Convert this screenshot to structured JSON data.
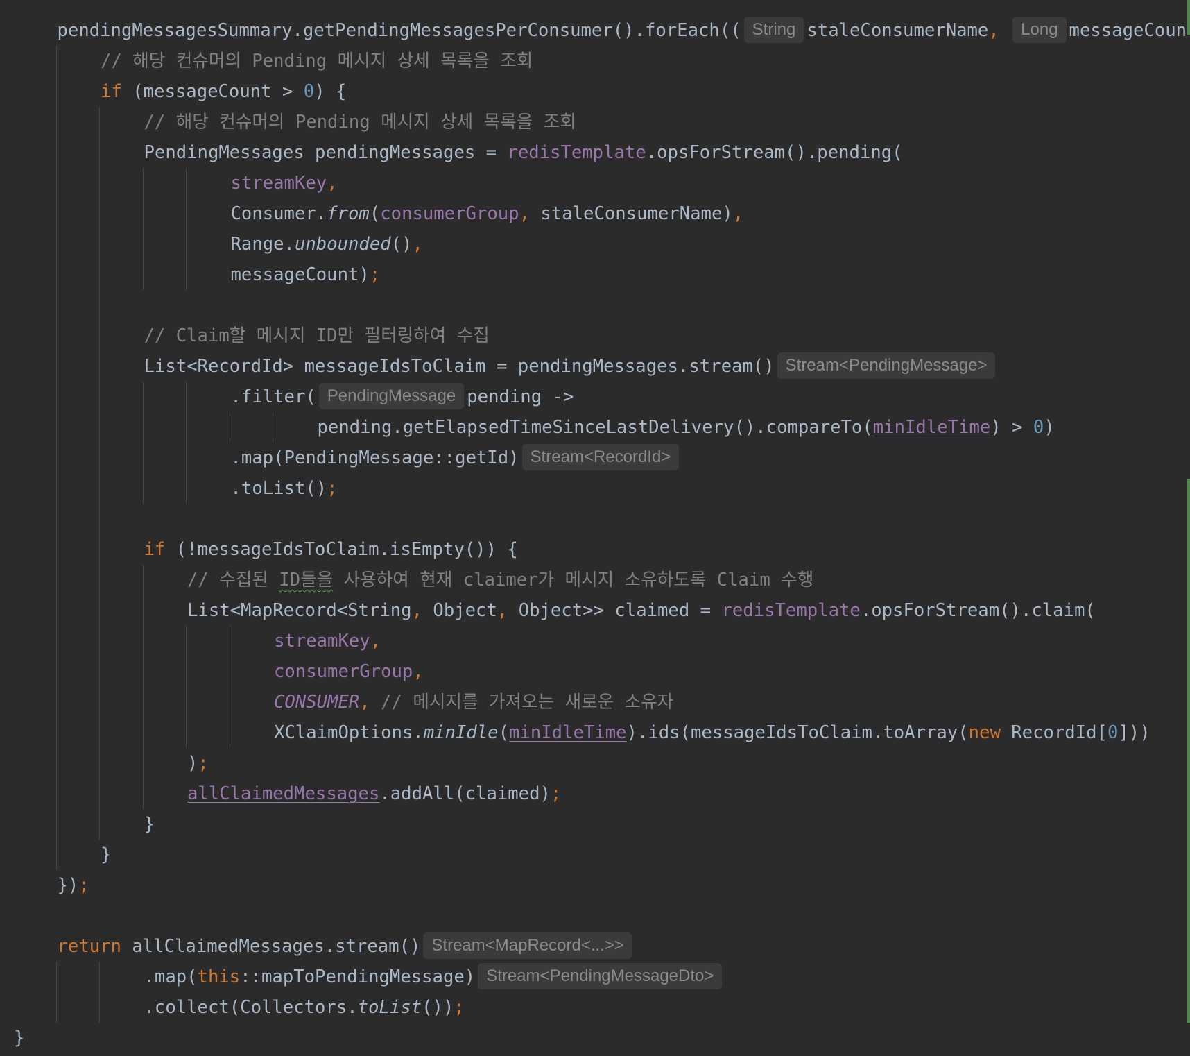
{
  "colors": {
    "background": "#2b2b2b",
    "default_text": "#a9b7c6",
    "keyword": "#cc7832",
    "field": "#9876aa",
    "number": "#6897bb",
    "comment": "#808080",
    "inlay_hint_bg": "#3b3b3b",
    "inlay_hint_text": "#8a8a8a",
    "change_marker": "#4f8a4a"
  },
  "lines": [
    {
      "indent": 1,
      "tokens": [
        {
          "t": "pendingMessagesSummary.getPendingMessagesPerConsumer().forEach(("
        },
        {
          "t": "String",
          "k": "hint"
        },
        {
          "t": "staleConsumerName"
        },
        {
          "t": ", ",
          "k": "punct"
        },
        {
          "t": "Long",
          "k": "hint"
        },
        {
          "t": "messageCount"
        }
      ]
    },
    {
      "indent": 2,
      "tokens": [
        {
          "t": "// 해당 컨슈머의 Pending 메시지 상세 목록을 조회",
          "k": "comment"
        }
      ]
    },
    {
      "indent": 2,
      "tokens": [
        {
          "t": "if",
          "k": "keyword"
        },
        {
          "t": " (messageCount > "
        },
        {
          "t": "0",
          "k": "number"
        },
        {
          "t": ") {"
        }
      ]
    },
    {
      "indent": 3,
      "tokens": [
        {
          "t": "// 해당 컨슈머의 Pending 메시지 상세 목록을 조회",
          "k": "comment"
        }
      ]
    },
    {
      "indent": 3,
      "tokens": [
        {
          "t": "PendingMessages pendingMessages = "
        },
        {
          "t": "redisTemplate",
          "k": "field"
        },
        {
          "t": ".opsForStream().pending("
        }
      ]
    },
    {
      "indent": 5,
      "tokens": [
        {
          "t": "streamKey",
          "k": "field"
        },
        {
          "t": ",",
          "k": "punct"
        }
      ]
    },
    {
      "indent": 5,
      "tokens": [
        {
          "t": "Consumer."
        },
        {
          "t": "from",
          "k": "italic"
        },
        {
          "t": "("
        },
        {
          "t": "consumerGroup",
          "k": "field"
        },
        {
          "t": ", ",
          "k": "punct"
        },
        {
          "t": "staleConsumerName)"
        },
        {
          "t": ",",
          "k": "punct"
        }
      ]
    },
    {
      "indent": 5,
      "tokens": [
        {
          "t": "Range."
        },
        {
          "t": "unbounded",
          "k": "italic"
        },
        {
          "t": "()"
        },
        {
          "t": ",",
          "k": "punct"
        }
      ]
    },
    {
      "indent": 5,
      "tokens": [
        {
          "t": "messageCount)"
        },
        {
          "t": ";",
          "k": "punct"
        }
      ]
    },
    {
      "indent": 0,
      "tokens": []
    },
    {
      "indent": 3,
      "tokens": [
        {
          "t": "// Claim할 메시지 ID만 필터링하여 수집",
          "k": "comment"
        }
      ]
    },
    {
      "indent": 3,
      "tokens": [
        {
          "t": "List<RecordId> messageIdsToClaim = pendingMessages.stream()"
        },
        {
          "t": "Stream<PendingMessage>",
          "k": "hint"
        }
      ]
    },
    {
      "indent": 5,
      "tokens": [
        {
          "t": ".filter("
        },
        {
          "t": "PendingMessage",
          "k": "hint"
        },
        {
          "t": "pending ->"
        }
      ]
    },
    {
      "indent": 7,
      "tokens": [
        {
          "t": "pending.getElapsedTimeSinceLastDelivery().compareTo("
        },
        {
          "t": "minIdleTime",
          "k": "field-underline"
        },
        {
          "t": ") > "
        },
        {
          "t": "0",
          "k": "number"
        },
        {
          "t": ")"
        }
      ]
    },
    {
      "indent": 5,
      "tokens": [
        {
          "t": ".map(PendingMessage::getId)"
        },
        {
          "t": "Stream<RecordId>",
          "k": "hint"
        }
      ]
    },
    {
      "indent": 5,
      "tokens": [
        {
          "t": ".toList()"
        },
        {
          "t": ";",
          "k": "punct"
        }
      ]
    },
    {
      "indent": 0,
      "tokens": []
    },
    {
      "indent": 3,
      "tokens": [
        {
          "t": "if",
          "k": "keyword"
        },
        {
          "t": " (!messageIdsToClaim.isEmpty()) {"
        }
      ]
    },
    {
      "indent": 4,
      "tokens": [
        {
          "t": "// 수집된 ",
          "k": "comment"
        },
        {
          "t": "ID들을",
          "k": "comment-squiggle"
        },
        {
          "t": " 사용하여 현재 claimer가 메시지 소유하도록 Claim 수행",
          "k": "comment"
        }
      ]
    },
    {
      "indent": 4,
      "tokens": [
        {
          "t": "List<MapRecord<String"
        },
        {
          "t": ", ",
          "k": "punct"
        },
        {
          "t": "Object"
        },
        {
          "t": ", ",
          "k": "punct"
        },
        {
          "t": "Object>> claimed = "
        },
        {
          "t": "redisTemplate",
          "k": "field"
        },
        {
          "t": ".opsForStream().claim("
        }
      ]
    },
    {
      "indent": 6,
      "tokens": [
        {
          "t": "streamKey",
          "k": "field"
        },
        {
          "t": ",",
          "k": "punct"
        }
      ]
    },
    {
      "indent": 6,
      "tokens": [
        {
          "t": "consumerGroup",
          "k": "field"
        },
        {
          "t": ",",
          "k": "punct"
        }
      ]
    },
    {
      "indent": 6,
      "tokens": [
        {
          "t": "CONSUMER",
          "k": "field-italic"
        },
        {
          "t": ", ",
          "k": "punct"
        },
        {
          "t": "// 메시지를 가져오는 새로운 소유자",
          "k": "comment"
        }
      ]
    },
    {
      "indent": 6,
      "tokens": [
        {
          "t": "XClaimOptions."
        },
        {
          "t": "minIdle",
          "k": "italic"
        },
        {
          "t": "("
        },
        {
          "t": "minIdleTime",
          "k": "field-underline"
        },
        {
          "t": ").ids(messageIdsToClaim.toArray("
        },
        {
          "t": "new",
          "k": "keyword"
        },
        {
          "t": " RecordId["
        },
        {
          "t": "0",
          "k": "number"
        },
        {
          "t": "]))"
        }
      ]
    },
    {
      "indent": 4,
      "tokens": [
        {
          "t": ")"
        },
        {
          "t": ";",
          "k": "punct"
        }
      ]
    },
    {
      "indent": 4,
      "tokens": [
        {
          "t": "allClaimedMessages",
          "k": "field-underline"
        },
        {
          "t": ".addAll(claimed)"
        },
        {
          "t": ";",
          "k": "punct"
        }
      ]
    },
    {
      "indent": 3,
      "tokens": [
        {
          "t": "}"
        }
      ]
    },
    {
      "indent": 2,
      "tokens": [
        {
          "t": "}"
        }
      ]
    },
    {
      "indent": 1,
      "tokens": [
        {
          "t": "})"
        },
        {
          "t": ";",
          "k": "punct"
        }
      ]
    },
    {
      "indent": 0,
      "tokens": []
    },
    {
      "indent": 1,
      "tokens": [
        {
          "t": "return",
          "k": "keyword"
        },
        {
          "t": " allClaimedMessages.stream()"
        },
        {
          "t": "Stream<MapRecord<...>>",
          "k": "hint"
        }
      ]
    },
    {
      "indent": 3,
      "tokens": [
        {
          "t": ".map("
        },
        {
          "t": "this",
          "k": "keyword"
        },
        {
          "t": "::mapToPendingMessage)"
        },
        {
          "t": "Stream<PendingMessageDto>",
          "k": "hint"
        }
      ]
    },
    {
      "indent": 3,
      "tokens": [
        {
          "t": ".collect(Collectors."
        },
        {
          "t": "toList",
          "k": "italic"
        },
        {
          "t": "())"
        },
        {
          "t": ";",
          "k": "punct"
        }
      ]
    },
    {
      "indent": 0,
      "tokens": [
        {
          "t": "}"
        }
      ]
    }
  ]
}
